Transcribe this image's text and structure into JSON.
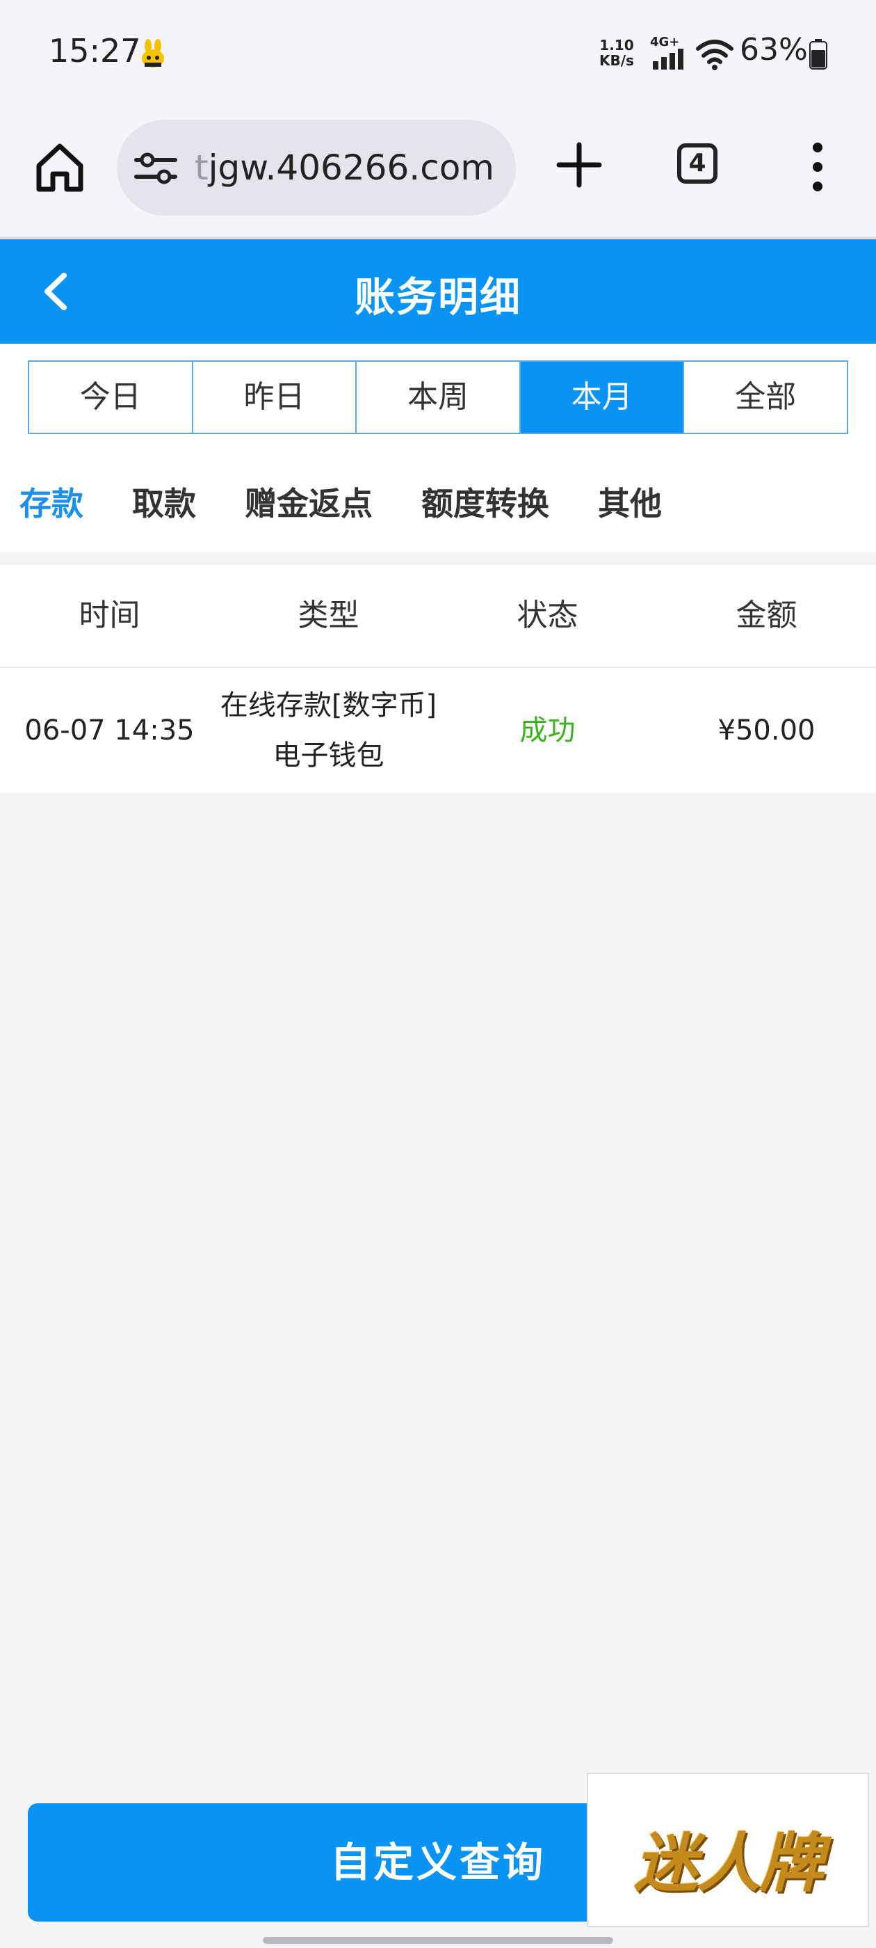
{
  "status_bar": {
    "time": "15:27",
    "net_speed_value": "1.10",
    "net_speed_unit": "KB/s",
    "network": "4G+",
    "battery": "63%"
  },
  "browser": {
    "url_prefix": "t",
    "url": "jgw.406266.com",
    "tab_count": "4"
  },
  "header": {
    "title": "账务明细"
  },
  "period_tabs": [
    {
      "label": "今日",
      "active": false
    },
    {
      "label": "昨日",
      "active": false
    },
    {
      "label": "本周",
      "active": false
    },
    {
      "label": "本月",
      "active": true
    },
    {
      "label": "全部",
      "active": false
    }
  ],
  "category_tabs": [
    {
      "label": "存款",
      "active": true
    },
    {
      "label": "取款",
      "active": false
    },
    {
      "label": "赠金返点",
      "active": false
    },
    {
      "label": "额度转换",
      "active": false
    },
    {
      "label": "其他",
      "active": false
    }
  ],
  "table": {
    "headers": [
      "时间",
      "类型",
      "状态",
      "金额"
    ],
    "rows": [
      {
        "time": "06-07 14:35",
        "type_line1": "在线存款[数字币]",
        "type_line2": "电子钱包",
        "status": "成功",
        "amount": "¥50.00"
      }
    ]
  },
  "footer": {
    "query_button": "自定义查询",
    "brand": "迷人牌"
  },
  "colors": {
    "accent": "#0893f5",
    "success": "#3db11f",
    "active_category": "#1e8fe8"
  }
}
